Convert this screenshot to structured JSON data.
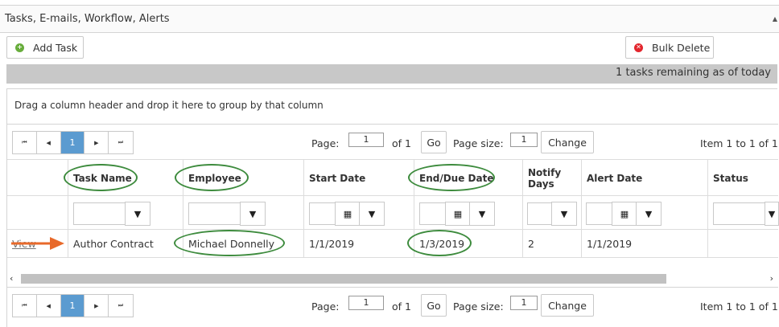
{
  "panel": {
    "title": "Tasks, E-mails, Workflow, Alerts",
    "collapse_glyph": "▲"
  },
  "toolbar": {
    "add_task": "Add Task",
    "bulk_delete": "Bulk Delete",
    "add_glyph": "+",
    "delete_glyph": "✕"
  },
  "status": {
    "remaining": "1 tasks remaining as of today"
  },
  "grid": {
    "group_hint": "Drag a column header and drop it here to group by that column",
    "pager": {
      "first": "⏮",
      "prev": "◀",
      "current": "1",
      "next": "▶",
      "last": "⏭",
      "page_label": "Page:",
      "page_value": "1",
      "of_label": "of 1",
      "go_label": "Go",
      "size_label": "Page size:",
      "size_value": "1",
      "change_label": "Change",
      "items_label": "Item 1 to 1 of 1"
    },
    "columns": [
      "Task Name",
      "Employee",
      "Start Date",
      "End/Due Date",
      "Notify Days",
      "Alert Date",
      "Status"
    ],
    "filter_glyph": "▼",
    "calendar_glyph": "▦",
    "rows": [
      {
        "action": "View",
        "task_name": "Author Contract",
        "employee": "Michael Donnelly",
        "start_date": "1/1/2019",
        "end_date": "1/3/2019",
        "notify_days": "2",
        "alert_date": "1/1/2019",
        "status": ""
      }
    ],
    "scroll": {
      "left": "‹",
      "right": "›"
    }
  },
  "annotation": {
    "color": "#3d8b3d",
    "arrow_color": "#e8692a"
  }
}
